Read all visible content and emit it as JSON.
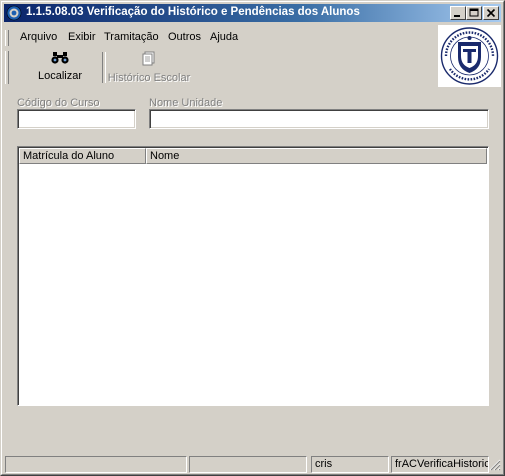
{
  "window": {
    "title": "1.1.5.08.03 Verificação do Histórico e Pendências dos Alunos",
    "controls": {
      "minimize": "_",
      "maximize": "□",
      "close": "✕"
    }
  },
  "menu": {
    "items": [
      {
        "label": "Arquivo"
      },
      {
        "label": "Exibir"
      },
      {
        "label": "Tramitação"
      },
      {
        "label": "Outros"
      },
      {
        "label": "Ajuda"
      }
    ]
  },
  "toolbar": {
    "localizar": {
      "label": "Localizar",
      "icon": "binoculars-icon",
      "enabled": true
    },
    "historico": {
      "label": "Histórico Escolar",
      "icon": "document-copy-icon",
      "enabled": false
    }
  },
  "logo": {
    "name": "universidade-seal"
  },
  "form": {
    "codigo_curso": {
      "label": "Código do Curso",
      "value": ""
    },
    "nome_unidade": {
      "label": "Nome Unidade",
      "value": ""
    }
  },
  "grid": {
    "columns": [
      "Matrícula do Aluno",
      "Nome"
    ],
    "rows": []
  },
  "status": {
    "panels": [
      "",
      "",
      "",
      "cris",
      "frACVerificaHistoric"
    ]
  },
  "colors": {
    "title_start": "#0a246a",
    "title_end": "#a6caf0",
    "face": "#d4d0c8"
  }
}
